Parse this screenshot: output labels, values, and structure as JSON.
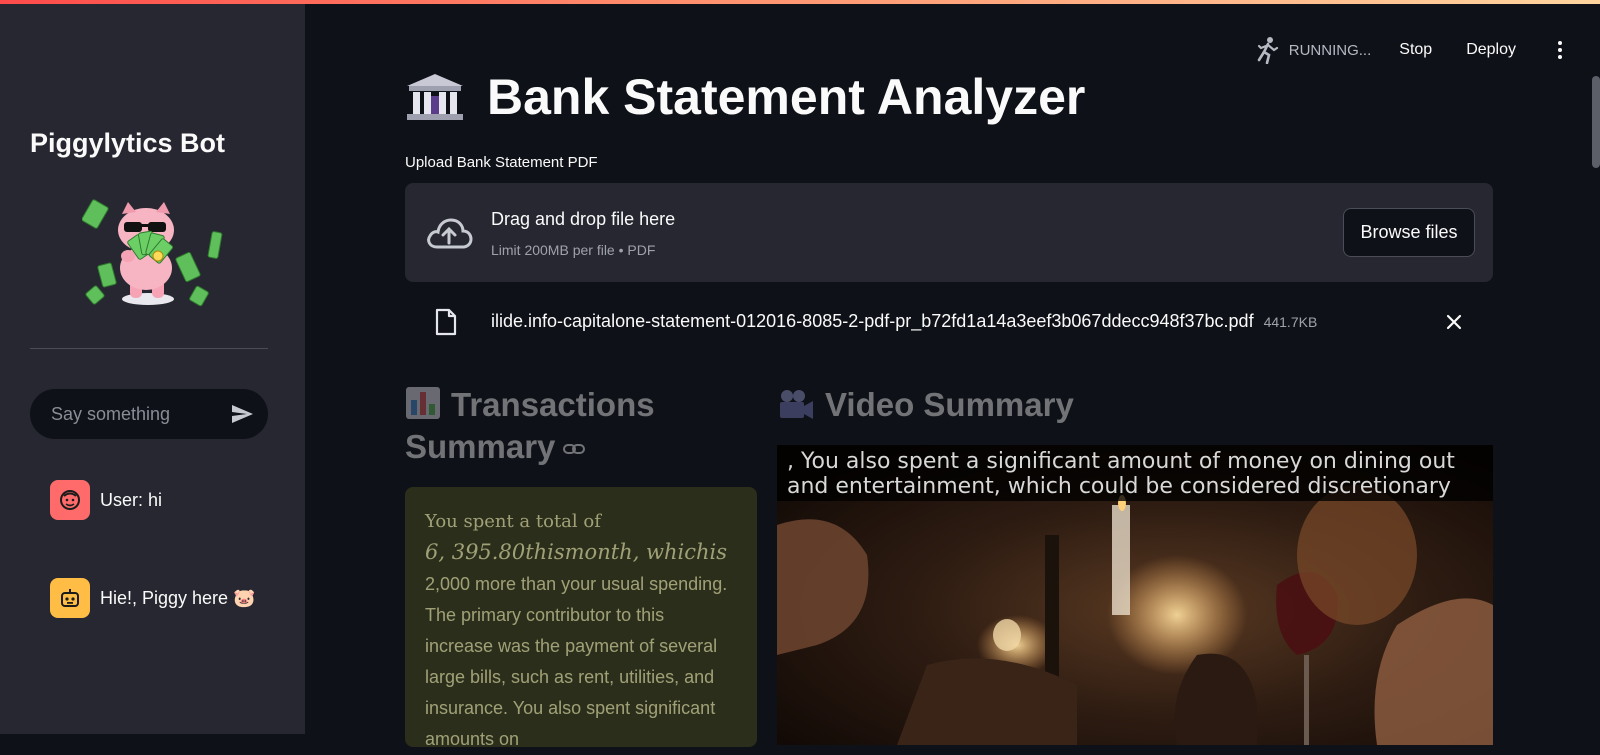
{
  "sidebar": {
    "title": "Piggylytics Bot",
    "chat_placeholder": "Say something",
    "messages": [
      {
        "role": "user",
        "text": "User: hi"
      },
      {
        "role": "bot",
        "text": "Hie!, Piggy here 🐷"
      }
    ]
  },
  "toolbar": {
    "status": "RUNNING...",
    "stop_label": "Stop",
    "deploy_label": "Deploy"
  },
  "main": {
    "title": "Bank Statement Analyzer",
    "title_icon": "bank-icon",
    "upload": {
      "label": "Upload Bank Statement PDF",
      "drop_title": "Drag and drop file here",
      "drop_subtitle": "Limit 200MB per file • PDF",
      "browse_label": "Browse files"
    },
    "file": {
      "name": "ilide.info-capitalone-statement-012016-8085-2-pdf-pr_b72fd1a14a3eef3b067ddecc948f37bc.pdf",
      "size": "441.7KB"
    },
    "transactions": {
      "title_line1": "Transactions",
      "title_line2": "Summary",
      "text_part1": "You spent a total of",
      "text_math": "6, 395.80thismonth, whichis",
      "text_part2": "2,000 more than your usual spending. The primary contributor to this increase was the payment of several large bills, such as rent, utilities, and insurance. You also spent significant amounts on"
    },
    "video": {
      "title": "Video Summary",
      "caption": ", You also spent a significant amount of money on dining out and entertainment, which could be considered discretionary spending"
    }
  },
  "colors": {
    "background": "#0e1117",
    "sidebar": "#262730",
    "accent": "#ff4b4b",
    "user_avatar": "#ff6b6b",
    "bot_avatar": "#ffbd45"
  }
}
